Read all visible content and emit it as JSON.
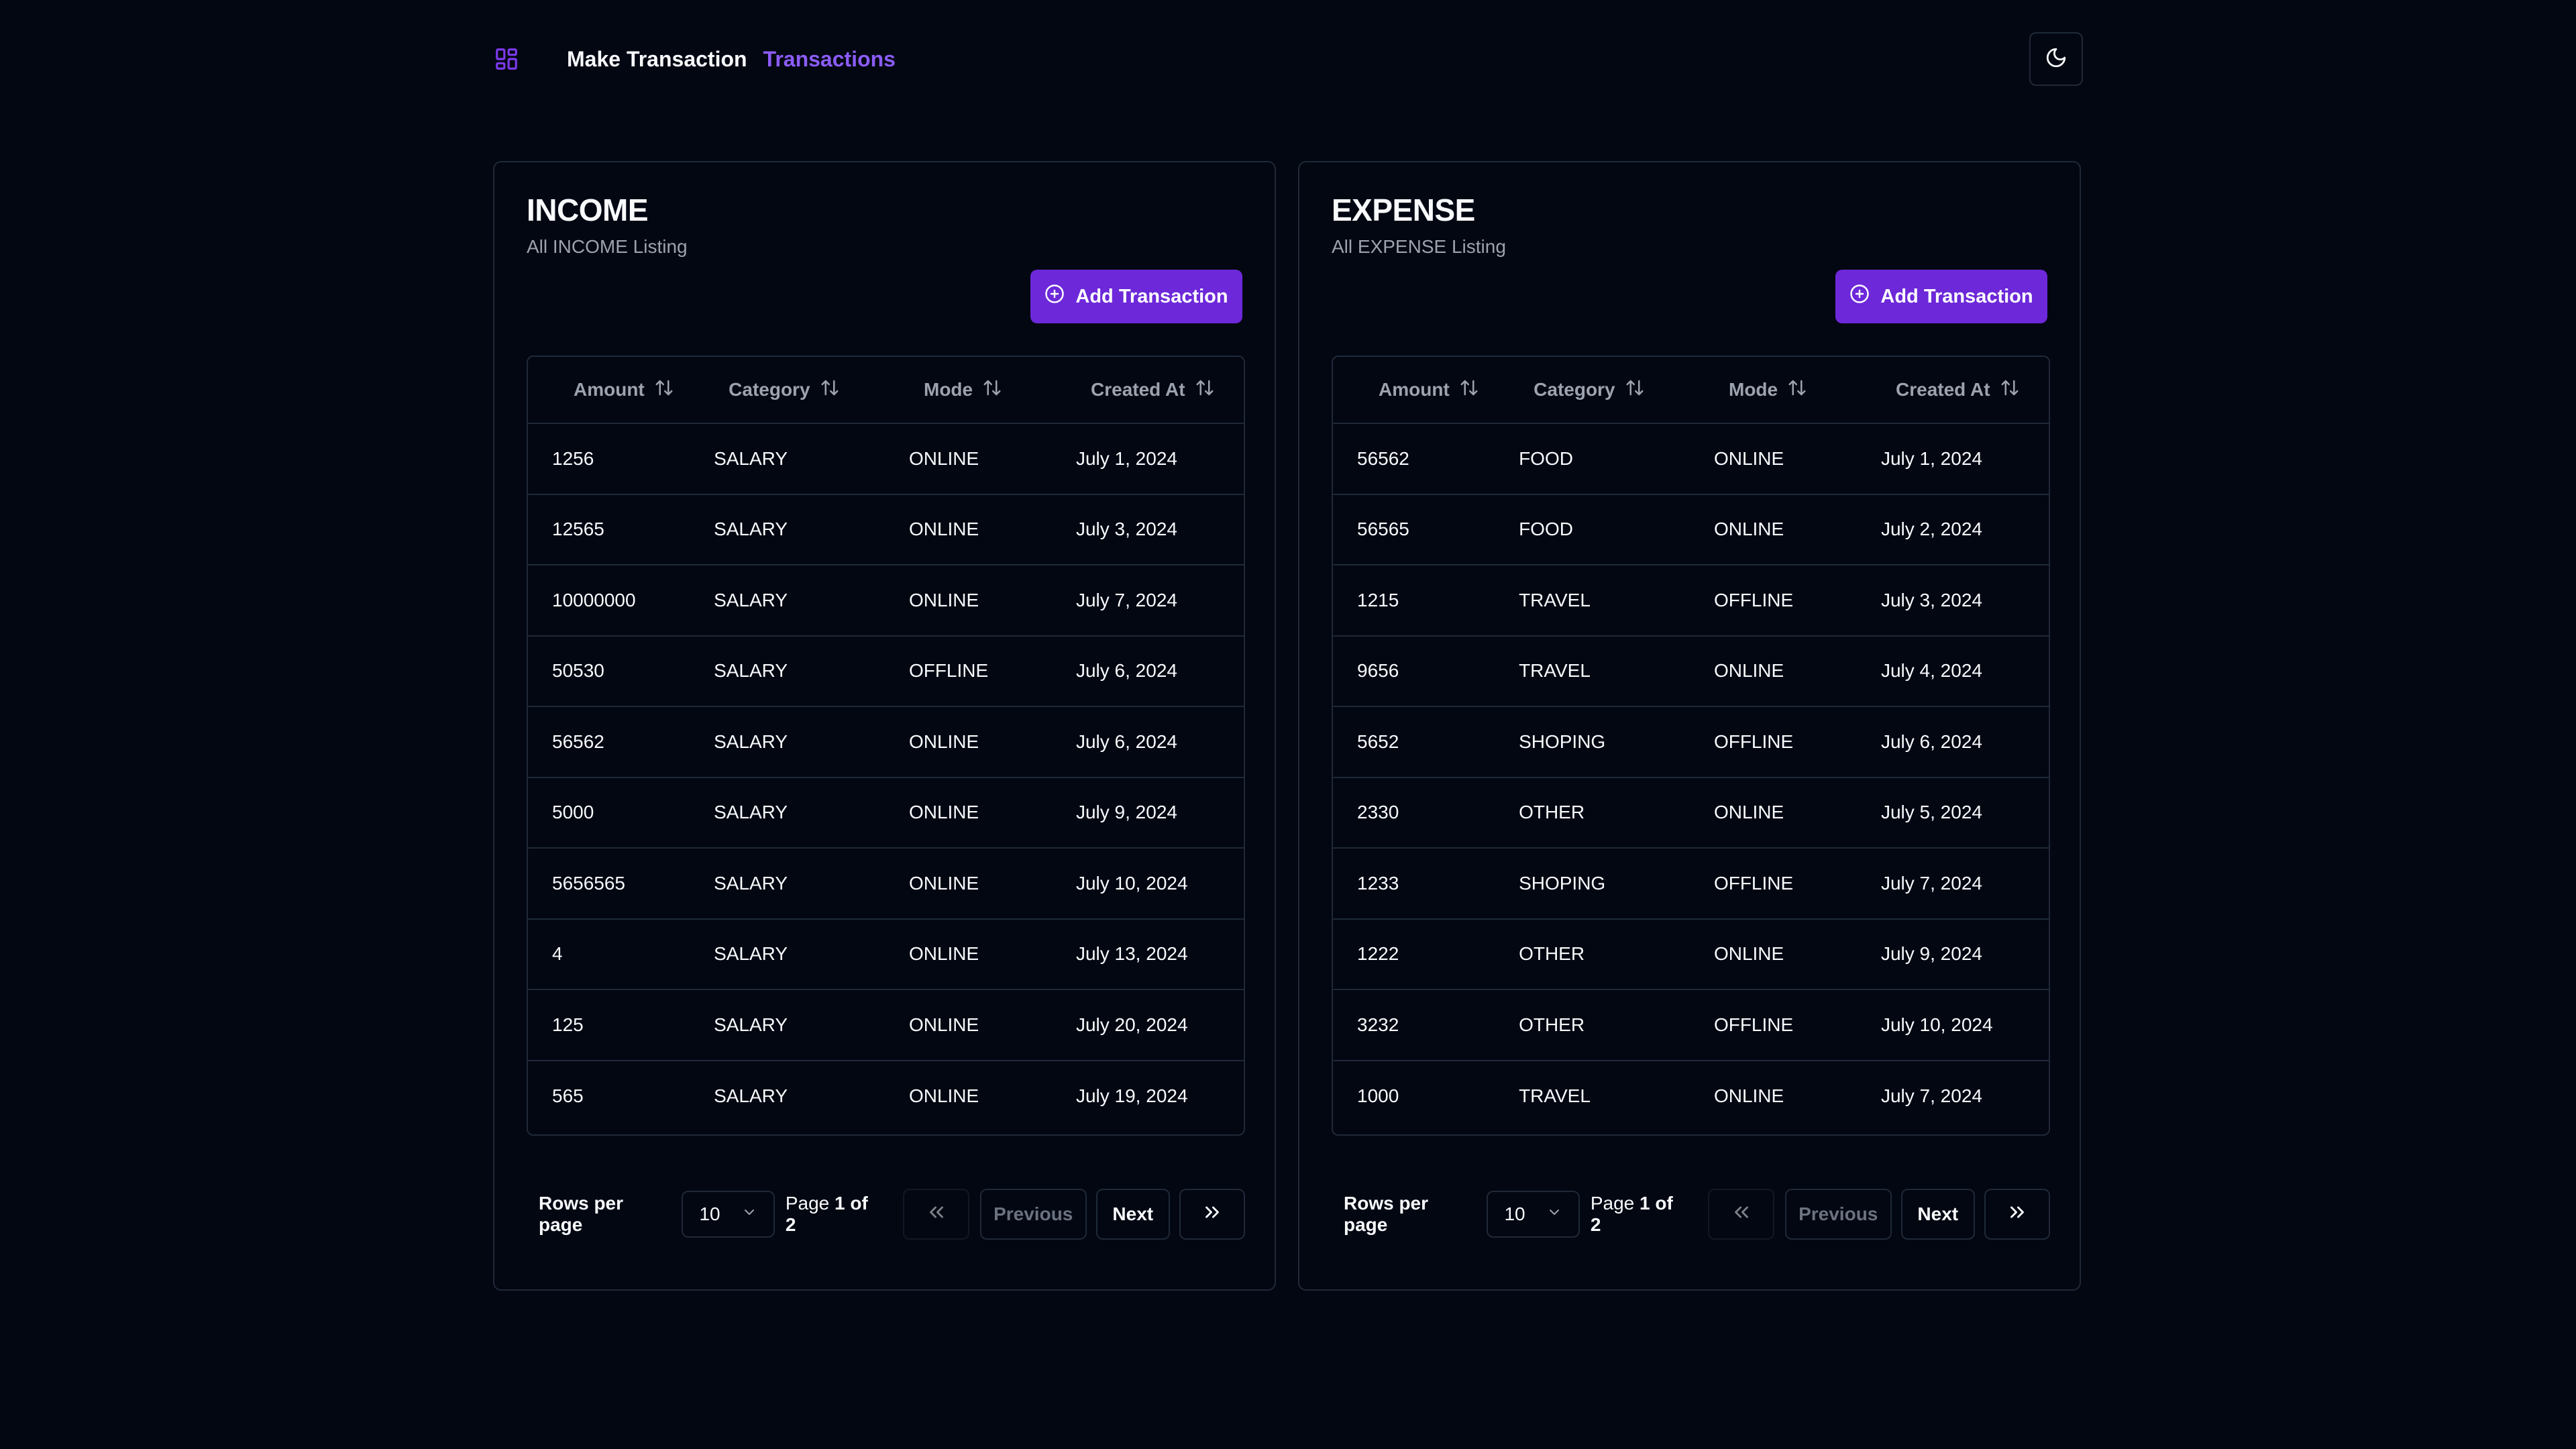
{
  "nav": {
    "make_transaction": "Make Transaction",
    "transactions": "Transactions"
  },
  "colors": {
    "background": "#030712",
    "accent": "#6d28d9",
    "active_link": "#8b5cf6",
    "border": "#1f2937",
    "muted_text": "#9ca3af"
  },
  "icons": {
    "logo": "layout-grid-icon",
    "theme_toggle": "moon-icon",
    "add": "plus-circle-icon",
    "sort": "arrow-up-down-icon",
    "first_page": "chevrons-left-icon",
    "last_page": "chevrons-right-icon",
    "select": "chevron-down-icon"
  },
  "income": {
    "title": "INCOME",
    "description": "All INCOME Listing",
    "add_label": "Add Transaction",
    "columns": [
      "Amount",
      "Category",
      "Mode",
      "Created At"
    ],
    "rows": [
      [
        "1256",
        "SALARY",
        "ONLINE",
        "July 1, 2024"
      ],
      [
        "12565",
        "SALARY",
        "ONLINE",
        "July 3, 2024"
      ],
      [
        "10000000",
        "SALARY",
        "ONLINE",
        "July 7, 2024"
      ],
      [
        "50530",
        "SALARY",
        "OFFLINE",
        "July 6, 2024"
      ],
      [
        "56562",
        "SALARY",
        "ONLINE",
        "July 6, 2024"
      ],
      [
        "5000",
        "SALARY",
        "ONLINE",
        "July 9, 2024"
      ],
      [
        "5656565",
        "SALARY",
        "ONLINE",
        "July 10, 2024"
      ],
      [
        "4",
        "SALARY",
        "ONLINE",
        "July 13, 2024"
      ],
      [
        "125",
        "SALARY",
        "ONLINE",
        "July 20, 2024"
      ],
      [
        "565",
        "SALARY",
        "ONLINE",
        "July 19, 2024"
      ]
    ],
    "pagination": {
      "rows_per_page_label": "Rows per page",
      "rows_per_page_value": "10",
      "page_prefix": "Page",
      "page_current": "1 of 2",
      "previous": "Previous",
      "next": "Next"
    }
  },
  "expense": {
    "title": "EXPENSE",
    "description": "All EXPENSE Listing",
    "add_label": "Add Transaction",
    "columns": [
      "Amount",
      "Category",
      "Mode",
      "Created At"
    ],
    "rows": [
      [
        "56562",
        "FOOD",
        "ONLINE",
        "July 1, 2024"
      ],
      [
        "56565",
        "FOOD",
        "ONLINE",
        "July 2, 2024"
      ],
      [
        "1215",
        "TRAVEL",
        "OFFLINE",
        "July 3, 2024"
      ],
      [
        "9656",
        "TRAVEL",
        "ONLINE",
        "July 4, 2024"
      ],
      [
        "5652",
        "SHOPING",
        "OFFLINE",
        "July 6, 2024"
      ],
      [
        "2330",
        "OTHER",
        "ONLINE",
        "July 5, 2024"
      ],
      [
        "1233",
        "SHOPING",
        "OFFLINE",
        "July 7, 2024"
      ],
      [
        "1222",
        "OTHER",
        "ONLINE",
        "July 9, 2024"
      ],
      [
        "3232",
        "OTHER",
        "OFFLINE",
        "July 10, 2024"
      ],
      [
        "1000",
        "TRAVEL",
        "ONLINE",
        "July 7, 2024"
      ]
    ],
    "pagination": {
      "rows_per_page_label": "Rows per page",
      "rows_per_page_value": "10",
      "page_prefix": "Page",
      "page_current": "1 of 2",
      "previous": "Previous",
      "next": "Next"
    }
  }
}
